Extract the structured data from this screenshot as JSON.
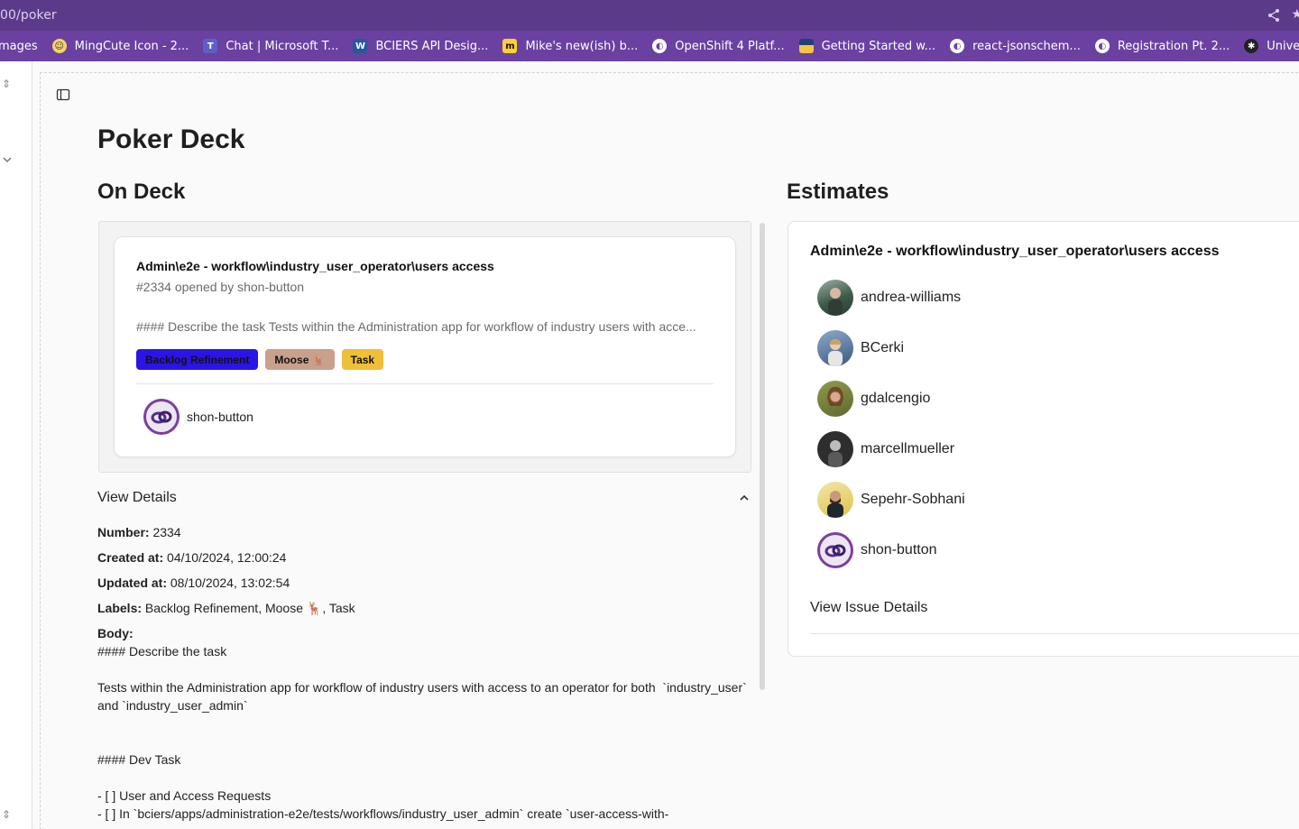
{
  "browser": {
    "url": "00/poker",
    "bookmarks": [
      {
        "label": "mages",
        "icon": "none-icon"
      },
      {
        "label": "MingCute Icon - 2...",
        "icon": "smiley-icon",
        "color": "#f4d46a"
      },
      {
        "label": "Chat | Microsoft T...",
        "icon": "teams-icon",
        "color": "#5b5fc7"
      },
      {
        "label": "BCIERS API Desig...",
        "icon": "word-icon",
        "color": "#2b579a"
      },
      {
        "label": "Mike's new(ish) b...",
        "icon": "miro-icon",
        "color": "#ffd02f"
      },
      {
        "label": "OpenShift 4 Platf...",
        "icon": "globe-icon",
        "color": "#ffffff"
      },
      {
        "label": "Getting Started w...",
        "icon": "bc-flag-icon",
        "color": "#f4c542"
      },
      {
        "label": "react-jsonschem...",
        "icon": "globe-icon",
        "color": "#ffffff"
      },
      {
        "label": "Registration Pt. 2...",
        "icon": "globe-icon",
        "color": "#ffffff"
      },
      {
        "label": "Universal Json Sc...",
        "icon": "asterisk-icon",
        "color": "#222222"
      }
    ]
  },
  "page": {
    "title": "Poker Deck",
    "on_deck_heading": "On Deck",
    "estimates_heading": "Estimates"
  },
  "issue": {
    "title": "Admin\\e2e - workflow\\industry_user_operator\\users access",
    "meta": "#2334 opened by shon-button",
    "excerpt": "#### Describe the task Tests within the Administration app for workflow of industry users with acce...",
    "labels": [
      {
        "text": "Backlog Refinement",
        "bg": "#2a14e6",
        "fg": "#111111"
      },
      {
        "text": "Moose 🦌",
        "bg": "#c9a08b",
        "fg": "#111111"
      },
      {
        "text": "Task",
        "bg": "#efbf3a",
        "fg": "#111111"
      }
    ],
    "author": "shon-button"
  },
  "details": {
    "toggle_label": "View Details",
    "number_label": "Number:",
    "number_value": " 2334",
    "created_label": "Created at:",
    "created_value": " 04/10/2024, 12:00:24",
    "updated_label": "Updated at:",
    "updated_value": " 08/10/2024, 13:02:54",
    "labels_label": "Labels:",
    "labels_value": " Backlog Refinement, Moose 🦌, Task",
    "body_label": "Body:",
    "body_line1": "#### Describe the task",
    "body_line2": "Tests within the Administration app for workflow of industry users with access to an operator for both  `industry_user` and `industry_user_admin`",
    "body_line3": "#### Dev Task",
    "body_line4": "- [ ] User and Access Requests",
    "body_line5": "- [ ] In `bciers/apps/administration-e2e/tests/workflows/industry_user_admin` create `user-access-with-"
  },
  "estimates": {
    "issue_title": "Admin\\e2e - workflow\\industry_user_operator\\users access",
    "voters": [
      "andrea-williams",
      "BCerki",
      "gdalcengio",
      "marcellmueller",
      "Sepehr-Sobhani",
      "shon-button"
    ],
    "view_issue_label": "View Issue Details"
  }
}
